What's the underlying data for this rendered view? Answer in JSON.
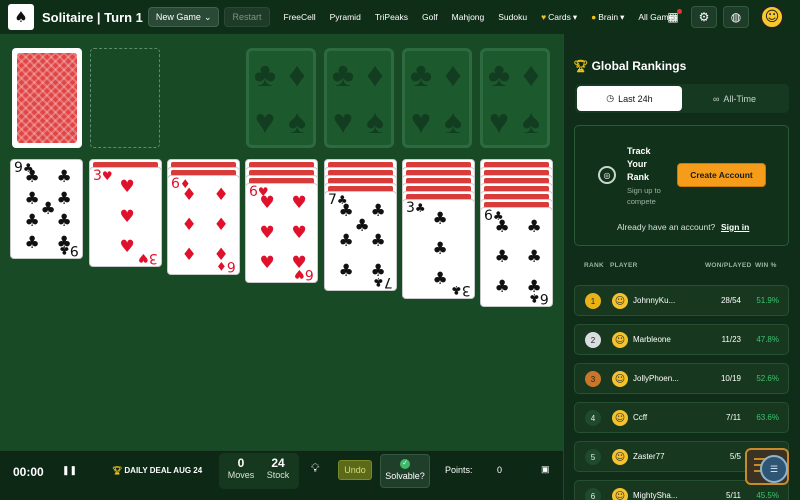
{
  "header": {
    "title": "Solitaire | Turn 1",
    "new_game": "New Game",
    "restart": "Restart",
    "nav": [
      "FreeCell",
      "Pyramid",
      "TriPeaks",
      "Golf",
      "Mahjong",
      "Sudoku",
      "Cards",
      "Brain",
      "All Games"
    ]
  },
  "tableau": [
    {
      "face_down": 0,
      "rank": "9",
      "suit": "♣",
      "color": "black"
    },
    {
      "face_down": 1,
      "rank": "3",
      "suit": "♥",
      "color": "red"
    },
    {
      "face_down": 2,
      "rank": "6",
      "suit": "♦",
      "color": "red"
    },
    {
      "face_down": 3,
      "rank": "6",
      "suit": "♥",
      "color": "red"
    },
    {
      "face_down": 4,
      "rank": "7",
      "suit": "♣",
      "color": "black"
    },
    {
      "face_down": 5,
      "rank": "3",
      "suit": "♣",
      "color": "black"
    },
    {
      "face_down": 6,
      "rank": "6",
      "suit": "♣",
      "color": "black"
    }
  ],
  "bottom": {
    "timer": "00:00",
    "daily": "DAILY DEAL AUG 24",
    "moves_value": "0",
    "moves_label": "Moves",
    "stock_value": "24",
    "stock_label": "Stock",
    "undo": "Undo",
    "solvable": "Solvable?",
    "points_label": "Points:",
    "points_value": "0"
  },
  "rankings": {
    "title": "Global Rankings",
    "tab_24h": "Last 24h",
    "tab_all": "All-Time",
    "track_title": "Track Your Rank",
    "track_sub": "Sign up to compete",
    "create": "Create Account",
    "have_account": "Already have an account?",
    "sign_in": "Sign in",
    "headers": {
      "rank": "RANK",
      "player": "PLAYER",
      "won": "WON/PLAYED",
      "win": "WIN %"
    },
    "rows": [
      {
        "rank": "1",
        "name": "JohnnyKu...",
        "wp": "28/54",
        "pct": "51.9%"
      },
      {
        "rank": "2",
        "name": "Marbleone",
        "wp": "11/23",
        "pct": "47.8%"
      },
      {
        "rank": "3",
        "name": "JollyPhoen...",
        "wp": "10/19",
        "pct": "52.6%"
      },
      {
        "rank": "4",
        "name": "Ccff",
        "wp": "7/11",
        "pct": "63.6%"
      },
      {
        "rank": "5",
        "name": "Zaster77",
        "wp": "5/5",
        "pct": ""
      },
      {
        "rank": "6",
        "name": "MightySha...",
        "wp": "5/11",
        "pct": "45.5%"
      }
    ]
  },
  "colors": {
    "accent": "#f59c1a",
    "table": "#184a26",
    "win": "#39c46e"
  }
}
